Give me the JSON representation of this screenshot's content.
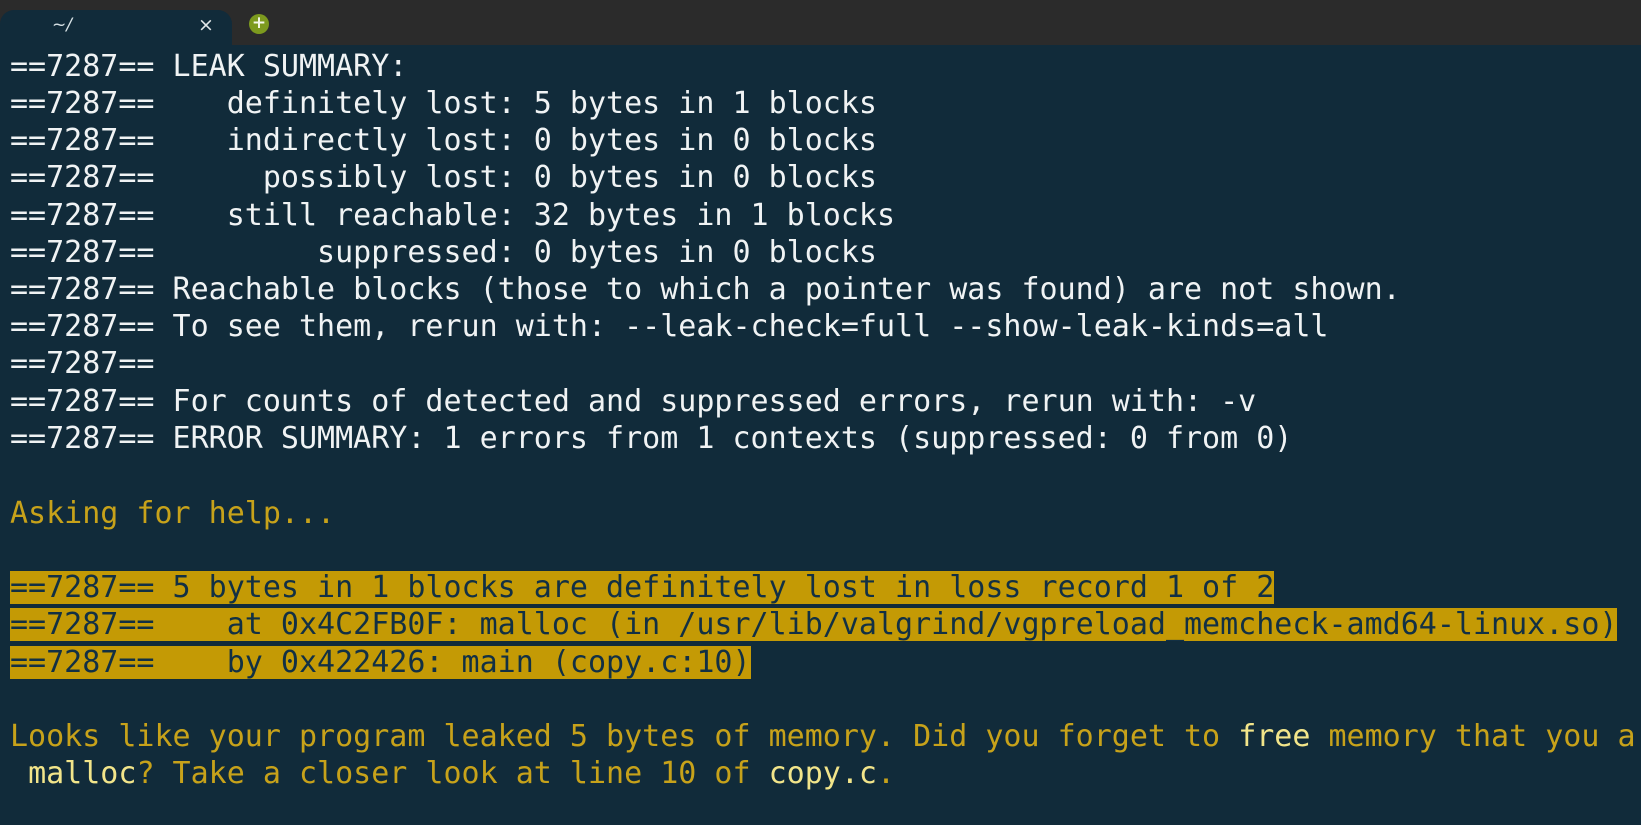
{
  "tab": {
    "title": "~/",
    "close_icon": "close-icon",
    "new_tab_icon": "plus-icon"
  },
  "terminal": {
    "lines": [
      "==7287== LEAK SUMMARY:",
      "==7287==    definitely lost: 5 bytes in 1 blocks",
      "==7287==    indirectly lost: 0 bytes in 0 blocks",
      "==7287==      possibly lost: 0 bytes in 0 blocks",
      "==7287==    still reachable: 32 bytes in 1 blocks",
      "==7287==         suppressed: 0 bytes in 0 blocks",
      "==7287== Reachable blocks (those to which a pointer was found) are not shown.",
      "==7287== To see them, rerun with: --leak-check=full --show-leak-kinds=all",
      "==7287==",
      "==7287== For counts of detected and suppressed errors, rerun with: -v",
      "==7287== ERROR SUMMARY: 1 errors from 1 contexts (suppressed: 0 from 0)"
    ],
    "help_line": "Asking for help...",
    "highlight_lines": [
      "==7287== 5 bytes in 1 blocks are definitely lost in loss record 1 of 2",
      "==7287==    at 0x4C2FB0F: malloc (in /usr/lib/valgrind/vgpreload_memcheck-amd64-linux.so)",
      "==7287==    by 0x422426: main (copy.c:10)"
    ],
    "help_message": {
      "part1": "Looks like your program leaked 5 bytes of memory. Did you forget to ",
      "free": "free",
      "part2": " memory that you a",
      "malloc": "malloc",
      "part3": "? Take a closer look at line 10 of ",
      "file": "copy.c",
      "part4": "."
    }
  },
  "colors": {
    "background": "#112b3a",
    "tabbar": "#2b2b2b",
    "text": "#f0f3f4",
    "help_text": "#c7a21a",
    "highlight_bg": "#c49a05",
    "highlight_text": "#123044",
    "new_tab_button": "#7d9a1e"
  }
}
